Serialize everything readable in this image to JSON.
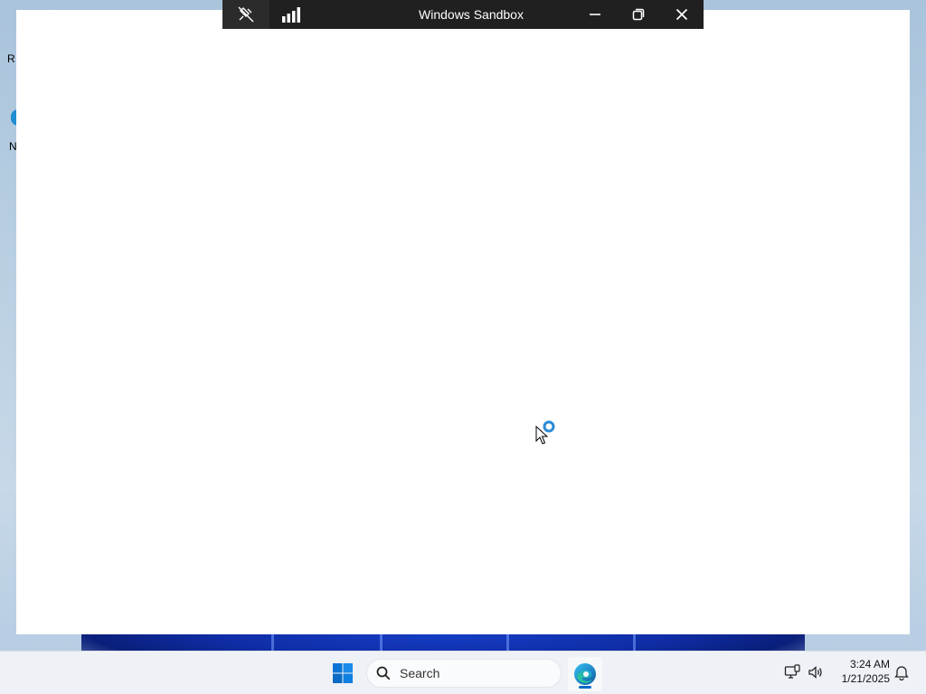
{
  "window": {
    "title": "Windows Sandbox"
  },
  "connection_bar": {
    "icons": [
      "unpin-icon",
      "signal-bars-icon"
    ],
    "buttons": [
      "minimize-icon",
      "restore-icon",
      "close-icon"
    ]
  },
  "desktop": {
    "partial_labels": [
      "R",
      "N"
    ]
  },
  "taskbar": {
    "search_placeholder": "Search",
    "pinned": [
      "windows-start-icon",
      "edge-browser-icon"
    ],
    "tray_icons": [
      "network-icon",
      "volume-icon",
      "notification-bell-icon"
    ],
    "time": "3:24 AM",
    "date": "1/21/2025"
  },
  "colors": {
    "conn_bar": "#202020",
    "taskbar": "#eef1f5",
    "accent_blue": "#0a68c9",
    "windows_logo": "#0078d4",
    "busy_cursor_ring": "#2b8ad6"
  },
  "cursor": {
    "state": "busy"
  }
}
